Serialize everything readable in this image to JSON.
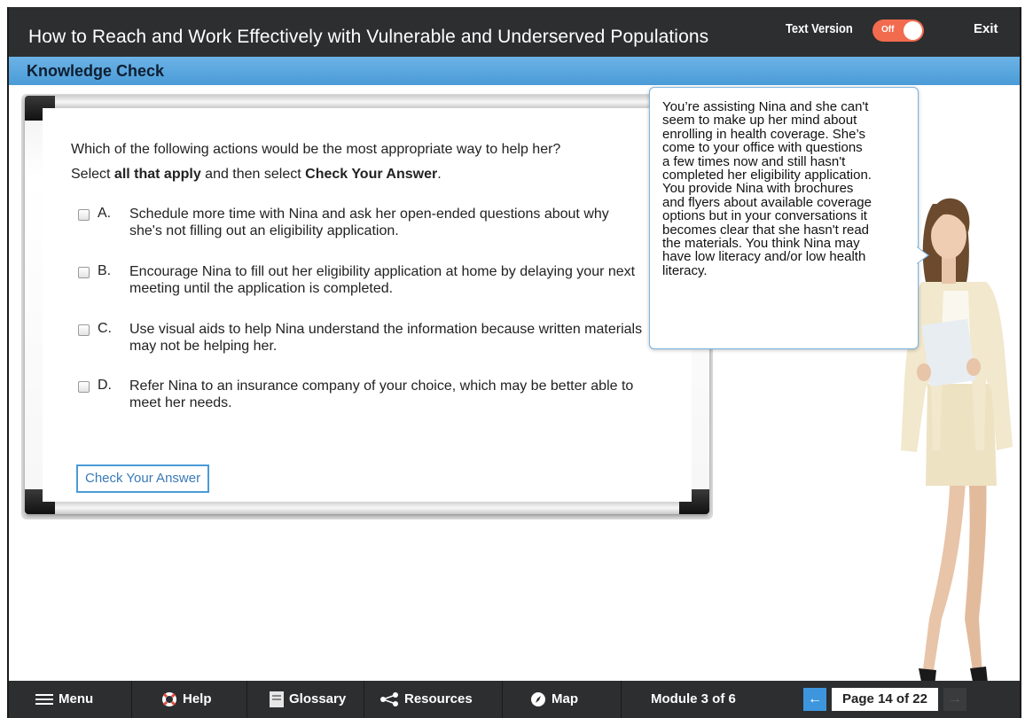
{
  "header": {
    "course_title": "How to Reach and Work Effectively with Vulnerable and Underserved Populations",
    "text_version_label": "Text Version",
    "toggle_state": "Off",
    "exit_label": "Exit"
  },
  "section": {
    "title": "Knowledge Check"
  },
  "question": {
    "prompt": "Which of the following actions would be the most appropriate way to help her?",
    "instruction_pre": "Select ",
    "instruction_bold1": "all that apply",
    "instruction_mid": " and then select ",
    "instruction_bold2": "Check Your Answer",
    "instruction_post": ".",
    "options": [
      {
        "letter": "A.",
        "text": "Schedule more time with Nina and ask her open-ended questions about why she's not filling out an eligibility application."
      },
      {
        "letter": "B.",
        "text": "Encourage Nina to fill out her eligibility application at home by delaying your next meeting until the application is completed."
      },
      {
        "letter": "C.",
        "text": "Use visual aids to help Nina understand the information because written materials may not be helping her."
      },
      {
        "letter": "D.",
        "text": "Refer Nina to an insurance company of your choice, which may be better able to meet her needs."
      }
    ],
    "check_button": "Check Your Answer"
  },
  "bubble": {
    "lines": [
      "You’re assisting Nina and she can't",
      "seem to make up her mind about",
      "enrolling in health coverage. She’s",
      "come to your office with questions",
      "a few times now and still hasn't",
      "completed her eligibility application.",
      "You provide Nina with brochures",
      "and flyers about available coverage",
      "options but in your conversations it",
      "becomes clear that she hasn't read",
      "the materials. You think Nina may",
      "have low literacy and/or low health",
      "literacy."
    ]
  },
  "nav": {
    "menu": "Menu",
    "help": "Help",
    "glossary": "Glossary",
    "resources": "Resources",
    "map": "Map",
    "module": "Module 3 of 6",
    "page": "Page 14 of 22",
    "prev_icon": "←",
    "next_icon": "→"
  },
  "colors": {
    "accent": "#4a9bd7",
    "toggle": "#f26b4e",
    "bar": "#2d2e30"
  }
}
